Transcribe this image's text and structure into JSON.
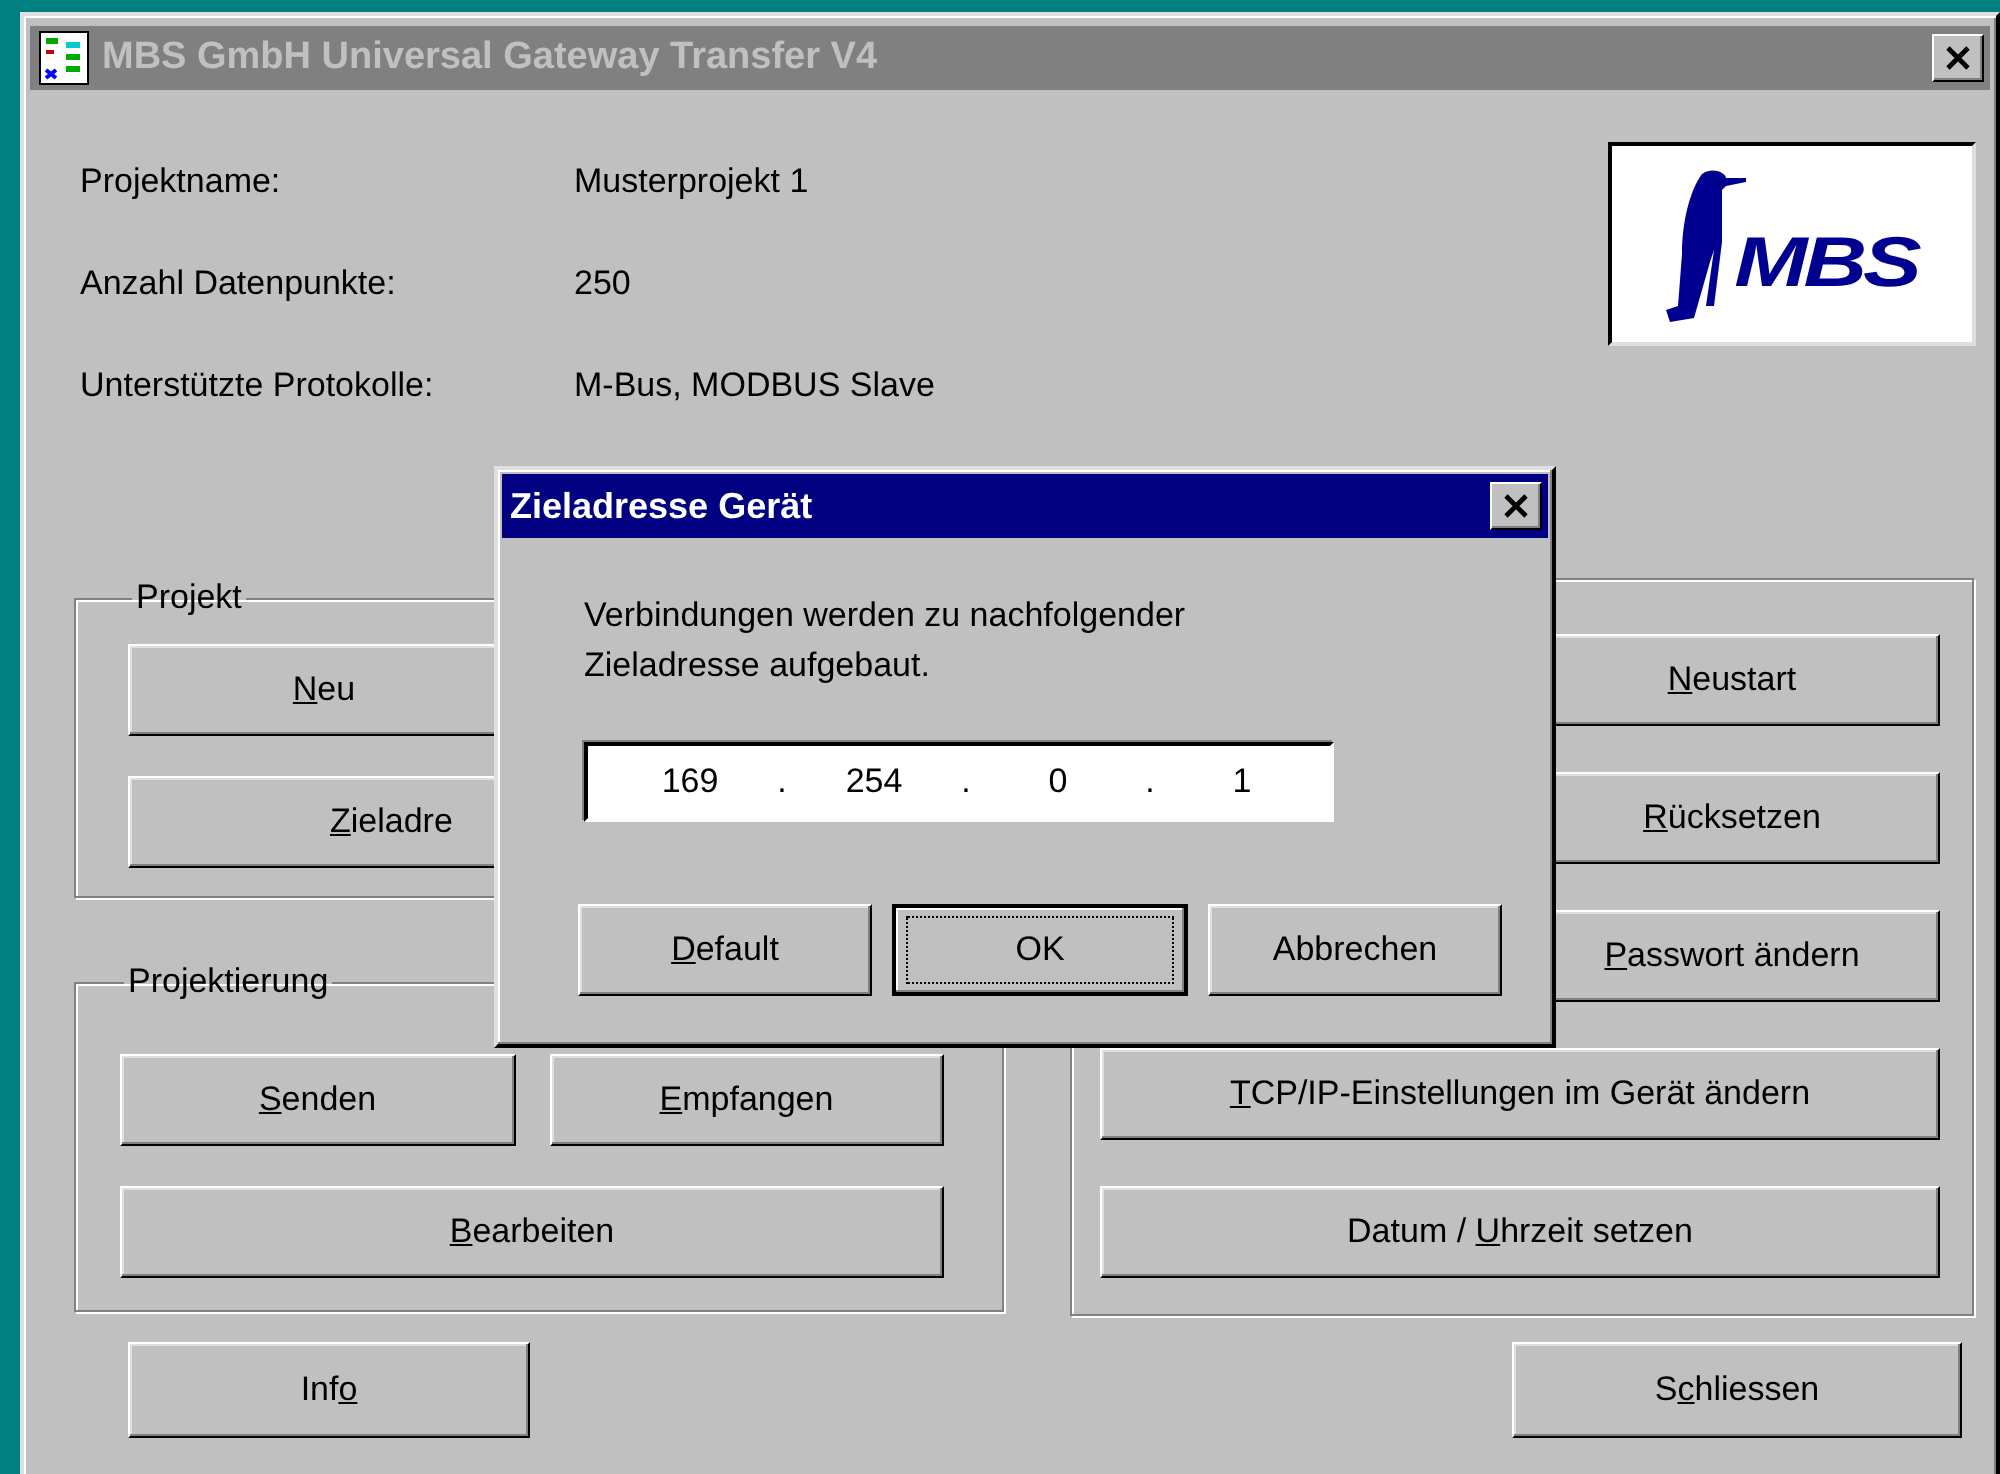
{
  "window": {
    "title": "MBS GmbH Universal Gateway Transfer V4",
    "active": false
  },
  "project_info": [
    {
      "label": "Projektname:",
      "value": "Musterprojekt 1"
    },
    {
      "label": "Anzahl Datenpunkte:",
      "value": "250"
    },
    {
      "label": "Unterstützte Protokolle:",
      "value": "M-Bus, MODBUS Slave"
    }
  ],
  "logo": {
    "text": "MBS"
  },
  "left_groups": [
    {
      "label": "Projekt",
      "rows": [
        [
          {
            "key": "N",
            "after": "eu"
          }
        ],
        [
          {
            "key": "Z",
            "after": "ieladre"
          }
        ]
      ]
    },
    {
      "label": "Projektierung",
      "rows": [
        [
          {
            "key": "S",
            "after": "enden"
          },
          {
            "key": "E",
            "after": "mpfangen"
          }
        ],
        [
          {
            "key": "B",
            "after": "earbeiten"
          }
        ]
      ]
    }
  ],
  "right_group": {
    "rows": [
      [
        {
          "key": "N",
          "after": "eustart"
        }
      ],
      [
        {
          "key": "R",
          "after": "ücksetzen"
        }
      ],
      [
        {
          "key": "P",
          "after": "asswort ändern"
        }
      ],
      [
        {
          "key": "T",
          "after": "CP/IP-Einstellungen im Gerät ändern"
        }
      ],
      [
        {
          "before": "Datum / ",
          "key": "U",
          "after": "hrzeit setzen"
        }
      ]
    ]
  },
  "bottom_buttons": [
    {
      "before": "Inf",
      "key": "o"
    },
    {
      "before": "S",
      "key": "c",
      "after": "hliessen"
    }
  ],
  "dialog": {
    "title": "Zieladresse Gerät",
    "active": true,
    "message": "Verbindungen werden zu nachfolgender Zieladresse aufgebaut.",
    "ip_field": {
      "octets": [
        "169",
        "254",
        "0",
        "1"
      ],
      "separator": "."
    },
    "buttons": [
      {
        "key": "D",
        "after": "efault",
        "default": false
      },
      {
        "before": "OK",
        "default": true
      },
      {
        "before": "Abbrechen",
        "default": false
      }
    ]
  }
}
